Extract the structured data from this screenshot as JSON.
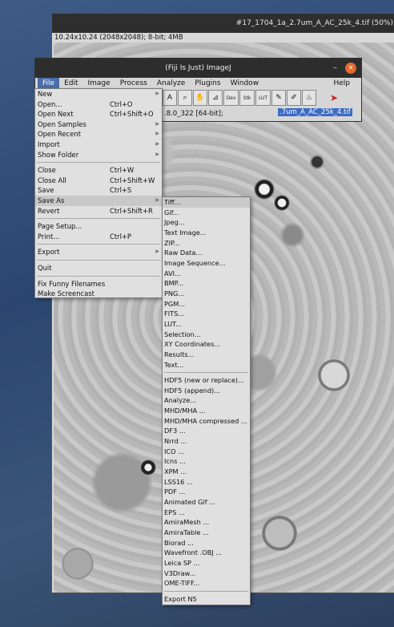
{
  "image_window": {
    "title": "#17_1704_1a_2.7um_A_AC_25k_4.tif (50%)",
    "info": "10.24x10.24  (2048x2048); 8-bit; 4MB"
  },
  "main_window": {
    "title": "(Fiji Is Just) ImageJ",
    "minimize": "–",
    "close": "×",
    "menubar": [
      "File",
      "Edit",
      "Image",
      "Process",
      "Analyze",
      "Plugins",
      "Window"
    ],
    "help": "Help",
    "tools": [
      "A",
      "⌕",
      "✋",
      "⊿",
      "Dev",
      "Stk",
      "LUT",
      "✎",
      "✐",
      "♨",
      "➤"
    ],
    "status": ".8.0_322 [64-bit];",
    "status_selected": ".7um_A_AC_25k_4.tif"
  },
  "file_menu": {
    "g1": [
      {
        "label": "New",
        "shortcut": "",
        "sub": true
      },
      {
        "label": "Open...",
        "shortcut": "Ctrl+O",
        "sub": false
      },
      {
        "label": "Open Next",
        "shortcut": "Ctrl+Shift+O",
        "sub": false
      },
      {
        "label": "Open Samples",
        "shortcut": "",
        "sub": true
      },
      {
        "label": "Open Recent",
        "shortcut": "",
        "sub": true
      },
      {
        "label": "Import",
        "shortcut": "",
        "sub": true
      },
      {
        "label": "Show Folder",
        "shortcut": "",
        "sub": true
      }
    ],
    "g2": [
      {
        "label": "Close",
        "shortcut": "Ctrl+W",
        "sub": false
      },
      {
        "label": "Close All",
        "shortcut": "Ctrl+Shift+W",
        "sub": false
      },
      {
        "label": "Save",
        "shortcut": "Ctrl+S",
        "sub": false
      },
      {
        "label": "Save As",
        "shortcut": "",
        "sub": true
      },
      {
        "label": "Revert",
        "shortcut": "Ctrl+Shift+R",
        "sub": false
      }
    ],
    "g3": [
      {
        "label": "Page Setup...",
        "shortcut": "",
        "sub": false
      },
      {
        "label": "Print...",
        "shortcut": "Ctrl+P",
        "sub": false
      }
    ],
    "g4": [
      {
        "label": "Export",
        "shortcut": "",
        "sub": true
      }
    ],
    "g5": [
      {
        "label": "Quit",
        "shortcut": "",
        "sub": false
      }
    ],
    "g6": [
      {
        "label": "Fix Funny Filenames",
        "shortcut": "",
        "sub": false
      },
      {
        "label": "Make Screencast",
        "shortcut": "",
        "sub": false
      }
    ]
  },
  "save_as_menu": {
    "g1": [
      "Tiff...",
      "Gif...",
      "Jpeg...",
      "Text Image...",
      "ZIP...",
      "Raw Data...",
      "Image Sequence...",
      "AVI...",
      "BMP...",
      "PNG...",
      "PGM...",
      "FITS...",
      "LUT...",
      "Selection...",
      "XY Coordinates...",
      "Results...",
      "Text..."
    ],
    "g2": [
      "HDF5 (new or replace)...",
      "HDF5 (append)...",
      "Analyze...",
      "MHD/MHA ...",
      "MHD/MHA compressed ...",
      "DF3 ...",
      "Nrrd ...",
      "ICO ...",
      "Icns ...",
      "XPM ...",
      "LSS16 ...",
      "PDF ...",
      "Animated Gif ...",
      "EPS ...",
      "AmiraMesh ...",
      "AmiraTable ...",
      "Biorad ...",
      "Wavefront .OBJ ...",
      "Leica SP ...",
      "V3Draw...",
      "OME-TIFF..."
    ],
    "g3": [
      "Export N5"
    ]
  }
}
